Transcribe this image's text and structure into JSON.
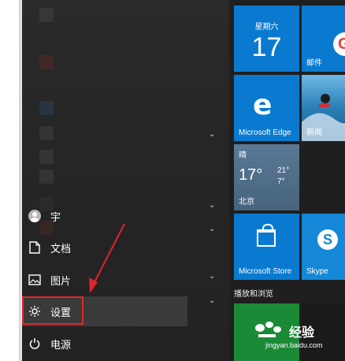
{
  "left_menu": {
    "user": {
      "label": "宇"
    },
    "documents": {
      "label": "文档"
    },
    "pictures": {
      "label": "图片"
    },
    "settings": {
      "label": "设置"
    },
    "power": {
      "label": "电源"
    }
  },
  "tiles": {
    "calendar": {
      "day": "星期六",
      "date": "17"
    },
    "mail": {
      "label": "邮件"
    },
    "edge": {
      "label": "Microsoft Edge"
    },
    "news": {
      "label": "新闻"
    },
    "weather": {
      "condition": "晴",
      "current": "17°",
      "high": "21°",
      "low": "7°",
      "city": "北京"
    },
    "store": {
      "label": "Microsoft Store"
    },
    "skype": {
      "label": "Skype"
    },
    "section": {
      "label": "播放和浏览"
    }
  },
  "watermark": {
    "text": "经验",
    "url": "jingyan.baidu.com"
  },
  "colors": {
    "tile_blue": "#0a7ad1",
    "highlight_red": "#e0252b",
    "arrow_red": "#e0252b"
  }
}
